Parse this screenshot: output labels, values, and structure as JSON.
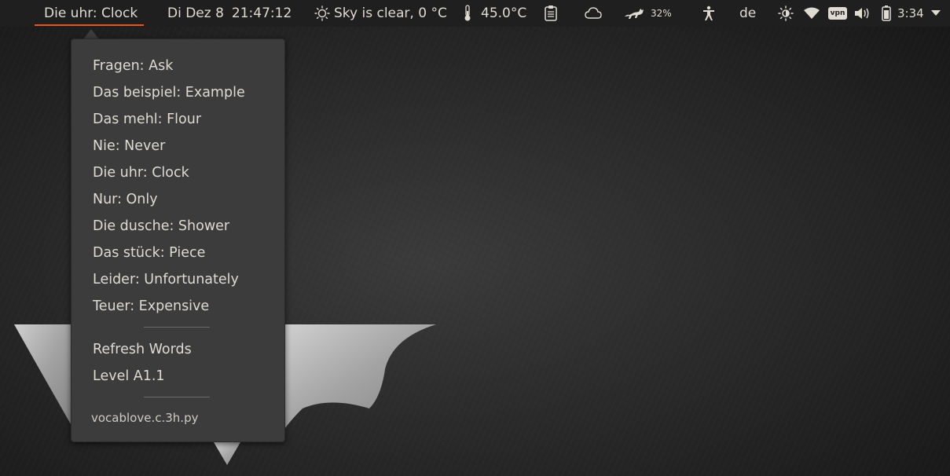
{
  "panel": {
    "active_item": "Die uhr: Clock",
    "date": "Di Dez 8",
    "time": "21:47:12",
    "weather": "Sky is clear, 0 °C",
    "temperature": "45.0°C",
    "battery_indicator_percent": "32%",
    "keyboard_layout": "de",
    "clock": "3:34",
    "accent_color": "#e95420",
    "icons": [
      "sun-icon",
      "thermometer-icon",
      "clipboard-icon",
      "cloud-icon",
      "cat-icon",
      "accessibility-icon",
      "brightness-icon",
      "wifi-icon",
      "vpn-icon",
      "volume-icon",
      "battery-icon",
      "dropdown-arrow-icon"
    ]
  },
  "menu": {
    "words": [
      {
        "label": "Fragen: Ask"
      },
      {
        "label": "Das beispiel: Example"
      },
      {
        "label": "Das mehl: Flour"
      },
      {
        "label": "Nie: Never"
      },
      {
        "label": "Die uhr: Clock"
      },
      {
        "label": "Nur: Only"
      },
      {
        "label": "Die dusche: Shower"
      },
      {
        "label": "Das stück: Piece"
      },
      {
        "label": "Leider: Unfortunately"
      },
      {
        "label": "Teuer: Expensive"
      }
    ],
    "refresh_label": "Refresh Words",
    "level_label": "Level A1.1",
    "app_name": "vocablove.c.3h.py"
  },
  "vpn_badge": "vpn"
}
